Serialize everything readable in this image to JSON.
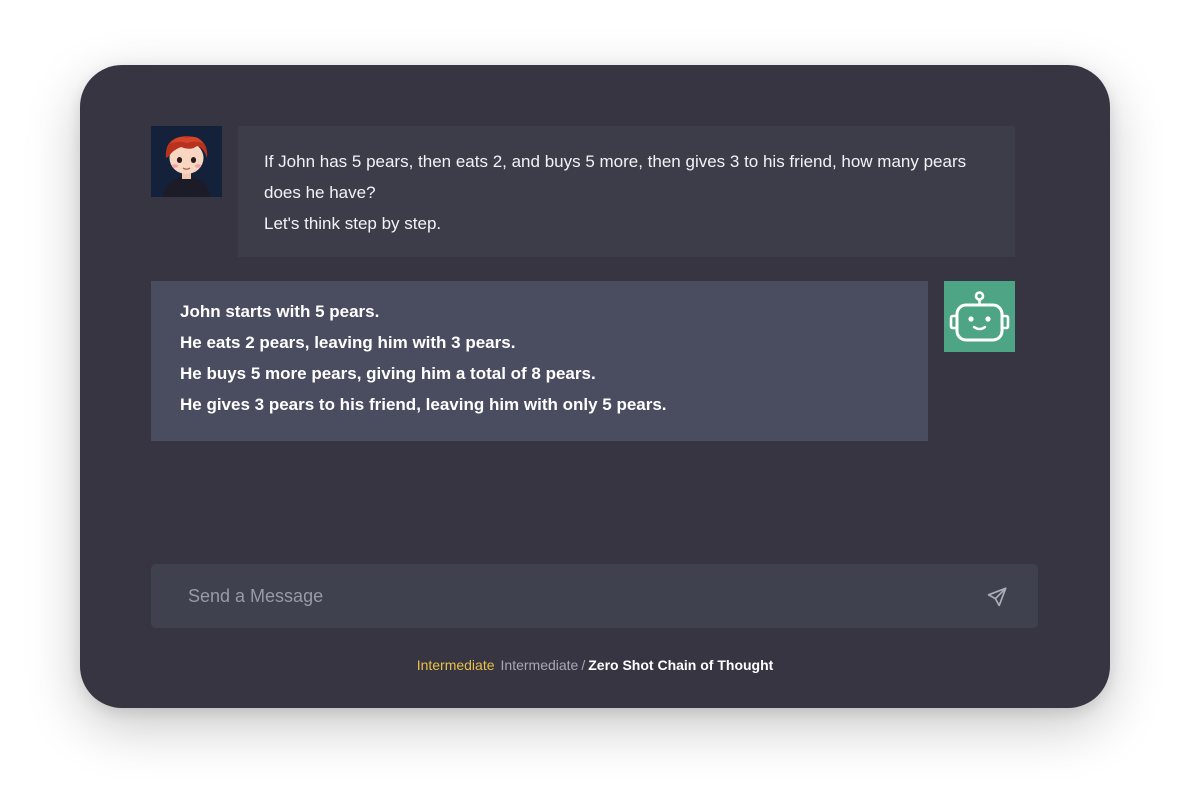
{
  "conversation": {
    "user_message": {
      "lines": [
        "If John has 5 pears, then eats 2, and buys 5 more, then gives 3 to his friend, how many pears does he have?",
        "Let's think step by step."
      ]
    },
    "bot_message": {
      "lines": [
        "John starts with 5 pears.",
        "He eats 2 pears, leaving him with 3 pears.",
        "He buys 5 more pears, giving him a total of 8 pears.",
        "He gives 3 pears to his friend, leaving him with only 5 pears."
      ]
    }
  },
  "composer": {
    "placeholder": "Send a Message"
  },
  "footer": {
    "level_badge": "Intermediate",
    "breadcrumb_parent": "Intermediate",
    "separator": "/",
    "breadcrumb_current": "Zero Shot Chain of Thought"
  },
  "icons": {
    "user_avatar": "cartoon-boy-avatar",
    "bot_avatar": "robot-icon",
    "send": "paper-plane-icon"
  },
  "colors": {
    "card_background": "#363541",
    "user_bubble": "#3d3d4a",
    "bot_bubble": "#4a4d60",
    "bot_avatar_background": "#4ea585",
    "composer_background": "#40414f",
    "level_accent": "#e8c04a"
  }
}
